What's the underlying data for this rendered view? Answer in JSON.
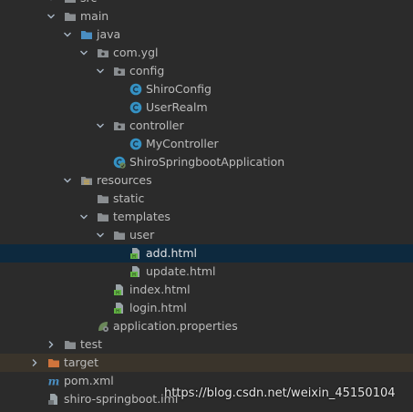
{
  "tree": [
    {
      "id": "src",
      "label": "src",
      "kind": "folder",
      "expanded": true
    },
    {
      "id": "main",
      "label": "main",
      "kind": "folder",
      "expanded": true
    },
    {
      "id": "java",
      "label": "java",
      "kind": "source-folder",
      "expanded": true
    },
    {
      "id": "com-ygl",
      "label": "com.ygl",
      "kind": "package",
      "expanded": true
    },
    {
      "id": "config",
      "label": "config",
      "kind": "package",
      "expanded": true
    },
    {
      "id": "shiroconfig",
      "label": "ShiroConfig",
      "kind": "class"
    },
    {
      "id": "userrealm",
      "label": "UserRealm",
      "kind": "class"
    },
    {
      "id": "controller",
      "label": "controller",
      "kind": "package",
      "expanded": true
    },
    {
      "id": "mycontroller",
      "label": "MyController",
      "kind": "class"
    },
    {
      "id": "application-class",
      "label": "ShiroSpringbootApplication",
      "kind": "spring-class"
    },
    {
      "id": "resources",
      "label": "resources",
      "kind": "resources-folder",
      "expanded": true
    },
    {
      "id": "static",
      "label": "static",
      "kind": "folder"
    },
    {
      "id": "templates",
      "label": "templates",
      "kind": "folder",
      "expanded": true
    },
    {
      "id": "user",
      "label": "user",
      "kind": "folder",
      "expanded": true
    },
    {
      "id": "add-html",
      "label": "add.html",
      "kind": "html-file",
      "selected": true
    },
    {
      "id": "update-html",
      "label": "update.html",
      "kind": "html-file"
    },
    {
      "id": "index-html",
      "label": "index.html",
      "kind": "html-file"
    },
    {
      "id": "login-html",
      "label": "login.html",
      "kind": "html-file"
    },
    {
      "id": "application-properties",
      "label": "application.properties",
      "kind": "properties-file"
    },
    {
      "id": "test",
      "label": "test",
      "kind": "folder",
      "expanded": false
    },
    {
      "id": "target",
      "label": "target",
      "kind": "excluded-folder",
      "expanded": false,
      "highlighted": true
    },
    {
      "id": "pom-xml",
      "label": "pom.xml",
      "kind": "maven-file"
    },
    {
      "id": "shiro-iml",
      "label": "shiro-springboot.iml",
      "kind": "iml-file"
    }
  ],
  "watermark": "https://blog.csdn.net/weixin_45150104",
  "colors": {
    "background": "#2b2b2b",
    "selection": "#0d293e",
    "excluded_row": "#3a342b",
    "text": "#bbbbbb",
    "folder": "#8a8e91",
    "source_folder": "#4a8ec2",
    "class_icon": "#3592c4",
    "html_icon": "#62b543",
    "excluded_folder": "#d0743c"
  }
}
